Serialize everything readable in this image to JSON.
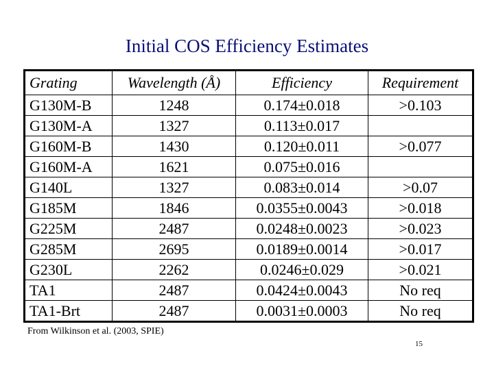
{
  "slide": {
    "title": "Initial COS Efficiency Estimates",
    "caption": "From Wilkinson et al. (2003, SPIE)",
    "page_number": "15",
    "title_color": "#0a0f78"
  },
  "table": {
    "headers": [
      "Grating",
      "Wavelength (Å)",
      "Efficiency",
      "Requirement"
    ],
    "rows": [
      [
        "G130M-B",
        "1248",
        "0.174±0.018",
        ">0.103"
      ],
      [
        "G130M-A",
        "1327",
        "0.113±0.017",
        ""
      ],
      [
        "G160M-B",
        "1430",
        "0.120±0.011",
        ">0.077"
      ],
      [
        "G160M-A",
        "1621",
        "0.075±0.016",
        ""
      ],
      [
        "G140L",
        "1327",
        "0.083±0.014",
        ">0.07"
      ],
      [
        "G185M",
        "1846",
        "0.0355±0.0043",
        ">0.018"
      ],
      [
        "G225M",
        "2487",
        "0.0248±0.0023",
        ">0.023"
      ],
      [
        "G285M",
        "2695",
        "0.0189±0.0014",
        ">0.017"
      ],
      [
        "G230L",
        "2262",
        "0.0246±0.029",
        ">0.021"
      ],
      [
        "TA1",
        "2487",
        "0.0424±0.0043",
        "No req"
      ],
      [
        "TA1-Brt",
        "2487",
        "0.0031±0.0003",
        "No req"
      ]
    ]
  }
}
